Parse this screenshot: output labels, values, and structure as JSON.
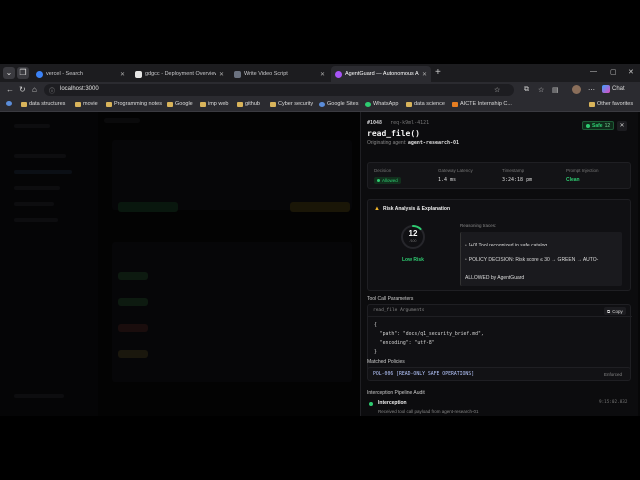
{
  "browser": {
    "tabs": [
      {
        "label": "vercel - Search",
        "icon_color": "#3b82f6",
        "active": false
      },
      {
        "label": "gdgcc - Deployment Overview",
        "icon_color": "#ffffff",
        "active": false
      },
      {
        "label": "Write Video Script",
        "icon_color": "#9ca3af",
        "active": false
      },
      {
        "label": "AgentGuard — Autonomous AI Ag",
        "icon_color": "#a855f7",
        "active": true
      }
    ],
    "url": "localhost:3000",
    "copilot_label": "Chat",
    "bookmarks": [
      "data structures",
      "movie",
      "Programming notes",
      "Google",
      "imp web",
      "github",
      "Cyber security",
      "Google Sites",
      "WhatsApp",
      "data science",
      "AICTE Internship C..."
    ],
    "other_favorites": "Other favorites"
  },
  "panel": {
    "id_tag": "#1048",
    "req_id": "req-k9ml-4121",
    "title": "read_file()",
    "origin_label": "Originating agent:",
    "origin_agent": "agent-research-01",
    "safe_label": "Safe",
    "safe_score": "12",
    "stats": [
      {
        "label": "Decision",
        "value": "Allowed"
      },
      {
        "label": "Gateway Latency",
        "value": "1.4 ms"
      },
      {
        "label": "Timestamp",
        "value": "3:24:18 pm"
      },
      {
        "label": "Prompt Injection",
        "value": "Clean"
      }
    ],
    "risk": {
      "heading": "Risk Analysis & Explanation",
      "score": "12",
      "score_max": "/100",
      "score_fraction": 0.12,
      "level": "Low Risk",
      "traces_label": "Reasoning traces:",
      "traces": [
        "[+0] Tool recognized in safe catalog",
        "POLICY DECISION: Risk score ≤ 30 → GREEN → AUTO-ALLOWED by AgentGuard"
      ]
    },
    "params": {
      "heading": "Tool Call Parameters",
      "code_title": "read_file Arguments",
      "copy_label": "Copy",
      "lines": [
        "{",
        "  \"path\": \"docs/q1_security_brief.md\",",
        "  \"encoding\": \"utf-8\"",
        "}"
      ]
    },
    "policies": {
      "heading": "Matched Policies",
      "items": [
        {
          "name": "POL-006 [READ-ONLY SAFE OPERATIONS]",
          "status": "Enforced"
        }
      ]
    },
    "audit": {
      "heading": "Interception Pipeline Audit",
      "steps": [
        {
          "title": "Interception",
          "detail": "Received tool call payload from agent-research-01",
          "time": "9:15:02.832"
        }
      ]
    }
  }
}
